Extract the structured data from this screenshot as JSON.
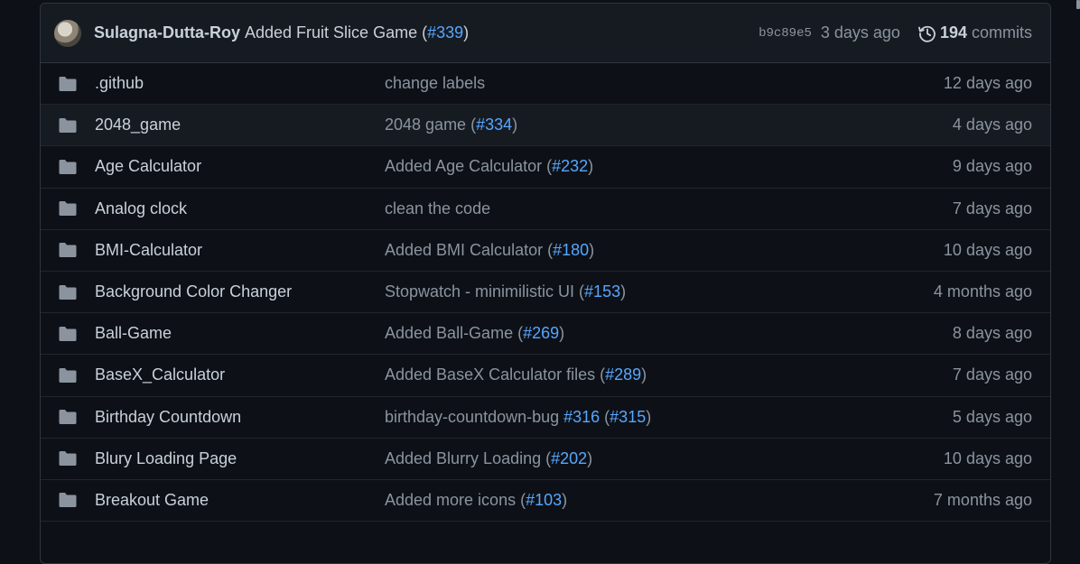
{
  "commit": {
    "author": "Sulagna-Dutta-Roy",
    "message": "Added Fruit Slice Game (",
    "pr": "#339",
    "close": ")",
    "sha": "b9c89e5",
    "ago": "3 days ago",
    "commit_count": "194",
    "commit_label": "commits"
  },
  "rows": [
    {
      "name": ".github",
      "msg": "change labels",
      "pr": "",
      "suffix": "",
      "time": "12 days ago"
    },
    {
      "name": "2048_game",
      "msg": "2048 game (",
      "pr": "#334",
      "suffix": ")",
      "time": "4 days ago"
    },
    {
      "name": "Age Calculator",
      "msg": "Added Age Calculator (",
      "pr": "#232",
      "suffix": ")",
      "time": "9 days ago"
    },
    {
      "name": "Analog clock",
      "msg": "clean the code",
      "pr": "",
      "suffix": "",
      "time": "7 days ago"
    },
    {
      "name": "BMI-Calculator",
      "msg": "Added BMI Calculator (",
      "pr": "#180",
      "suffix": ")",
      "time": "10 days ago"
    },
    {
      "name": "Background Color Changer",
      "msg": "Stopwatch - minimilistic UI (",
      "pr": "#153",
      "suffix": ")",
      "time": "4 months ago"
    },
    {
      "name": "Ball-Game",
      "msg": "Added Ball-Game (",
      "pr": "#269",
      "suffix": ")",
      "time": "8 days ago"
    },
    {
      "name": "BaseX_Calculator",
      "msg": "Added BaseX Calculator files (",
      "pr": "#289",
      "suffix": ")",
      "time": "7 days ago"
    },
    {
      "name": "Birthday Countdown",
      "msg": "birthday-countdown-bug ",
      "pr": "#316",
      "pr2": "#315",
      "suffix": ")",
      "time": "5 days ago"
    },
    {
      "name": "Blury Loading Page",
      "msg": "Added Blurry Loading (",
      "pr": "#202",
      "suffix": ")",
      "time": "10 days ago"
    },
    {
      "name": "Breakout Game",
      "msg": "Added more icons (",
      "pr": "#103",
      "suffix": ")",
      "time": "7 months ago"
    }
  ],
  "icons": {
    "folder": "folder-icon",
    "history": "history-icon"
  },
  "colors": {
    "background": "#0d1117",
    "header": "#161b22",
    "link": "#58a6ff",
    "border": "#30363d"
  }
}
